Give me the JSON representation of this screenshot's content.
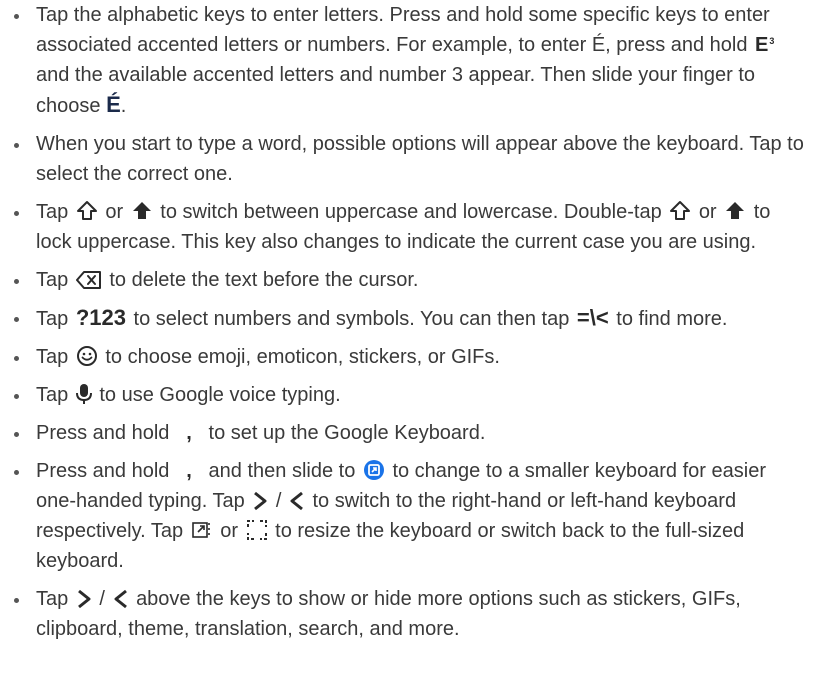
{
  "bullets": [
    {
      "p1": "Tap the alphabetic keys to enter letters. Press and hold some specific keys to enter associated accented letters or numbers. For example, to enter É, press and hold ",
      "key_e": "E",
      "key_e_sup": "3",
      "p2": " and the available accented letters and number 3 appear. Then slide your finger to choose ",
      "accent": "É",
      "p3": "."
    },
    {
      "text": "When you start to type a word, possible options will appear above the keyboard. Tap to select the correct one."
    },
    {
      "p1": "Tap ",
      "or1": " or ",
      "p2": " to switch between uppercase and lowercase. Double-tap ",
      "or2": " or ",
      "p3": " to lock uppercase. This key also changes to indicate the current case you are using."
    },
    {
      "p1": "Tap ",
      "p2": " to delete the text before the cursor."
    },
    {
      "p1": "Tap ",
      "key_numbers": "?123",
      "p2": " to select numbers and symbols. You can then tap ",
      "key_symbols": "=\\<",
      "p3": " to find more."
    },
    {
      "p1": "Tap ",
      "p2": " to choose emoji, emoticon, stickers, or GIFs."
    },
    {
      "p1": "Tap ",
      "p2": " to use Google voice typing."
    },
    {
      "p1": "Press and hold ",
      "key_comma": ",",
      "p2": " to set up the Google Keyboard."
    },
    {
      "p1": "Press and hold ",
      "key_comma": ",",
      "p2": " and then slide to ",
      "p3": " to change to a smaller keyboard for easier one-handed typing. Tap ",
      "slash1": "/",
      "p4": " to switch to the right-hand or left-hand keyboard respectively. Tap ",
      "or1": " or ",
      "p5": " to resize the keyboard or switch back to the full-sized keyboard."
    },
    {
      "p1": "Tap ",
      "slash1": "/",
      "p2": " above the keys to show or hide more options such as stickers, GIFs, clipboard, theme, translation, search, and more."
    }
  ],
  "icons": {
    "shift_outline": "shift-outline-icon",
    "shift_filled": "shift-filled-icon",
    "backspace": "backspace-icon",
    "emoji": "emoji-icon",
    "mic": "microphone-icon",
    "one_handed": "one-handed-mode-icon",
    "chevron_right": "chevron-right-icon",
    "chevron_left": "chevron-left-icon",
    "resize": "resize-icon",
    "fullscreen": "fullscreen-icon"
  },
  "colors": {
    "text": "#3a3a3a",
    "accent_blue": "#1a73e8",
    "accent_text": "#1b2a4a"
  }
}
